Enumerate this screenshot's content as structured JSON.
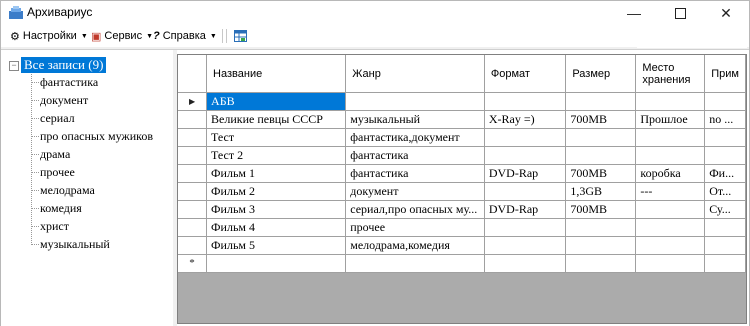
{
  "window": {
    "title": "Архивариус"
  },
  "toolbar": {
    "settings": "Настройки",
    "service": "Сервис",
    "help": "Справка"
  },
  "tree": {
    "root": "Все записи (9)",
    "toggle": "−",
    "items": [
      "фантастика",
      "документ",
      "сериал",
      "про опасных мужиков",
      "драма",
      "прочее",
      "мелодрама",
      "комедия",
      "христ",
      "музыкальный"
    ]
  },
  "grid": {
    "headers": [
      "Название",
      "Жанр",
      "Формат",
      "Размер",
      "Место хранения",
      "Прим"
    ],
    "current_row_marker": "▶",
    "new_row_marker": "*",
    "rows": [
      [
        "АБВ",
        "",
        "",
        "",
        "",
        ""
      ],
      [
        "Великие певцы СССР",
        "музыкальный",
        "X-Ray =)",
        "700MB",
        "Прошлое",
        "no ..."
      ],
      [
        "Тест",
        "фантастика,документ",
        "",
        "",
        "",
        ""
      ],
      [
        "Тест 2",
        "фантастика",
        "",
        "",
        "",
        ""
      ],
      [
        "Фильм 1",
        "фантастика",
        "DVD-Rap",
        "700MB",
        "коробка",
        "Фи..."
      ],
      [
        "Фильм 2",
        "документ",
        "",
        "1,3GB",
        "---",
        "От..."
      ],
      [
        "Фильм 3",
        "сериал,про опасных му...",
        "DVD-Rap",
        "700MB",
        "",
        "Су..."
      ],
      [
        "Фильм 4",
        "прочее",
        "",
        "",
        "",
        ""
      ],
      [
        "Фильм 5",
        "мелодрама,комедия",
        "",
        "",
        "",
        ""
      ],
      [
        "",
        "",
        "",
        "",
        "",
        ""
      ]
    ]
  }
}
